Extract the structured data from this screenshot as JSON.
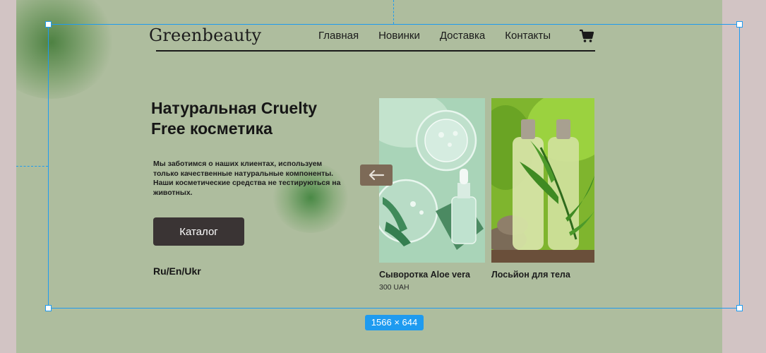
{
  "brand": {
    "logo": "Greenbeauty"
  },
  "nav": {
    "items": [
      "Главная",
      "Новинки",
      "Доставка",
      "Контакты"
    ],
    "cart_icon": "shopping-cart-icon"
  },
  "hero": {
    "title": "Натуральная Cruelty Free косметика",
    "description": "Мы заботимся о наших клиентах, используем только качественные натуральные компоненты. Наши косметические средства не тестируються на животных.",
    "catalog_button": "Каталог",
    "languages": "Ru/En/Ukr"
  },
  "products": [
    {
      "name": "Сыворотка Aloe vera",
      "price": "300 UAH"
    },
    {
      "name": "Лосьйон для тела",
      "price": ""
    }
  ],
  "slider": {
    "prev_icon": "arrow-left-icon"
  },
  "editor": {
    "selection_size": "1566 × 644"
  },
  "colors": {
    "background": "#aebd9e",
    "button": "#3a3434",
    "accent": "#7d6a57",
    "selection": "#1e9bf0"
  }
}
